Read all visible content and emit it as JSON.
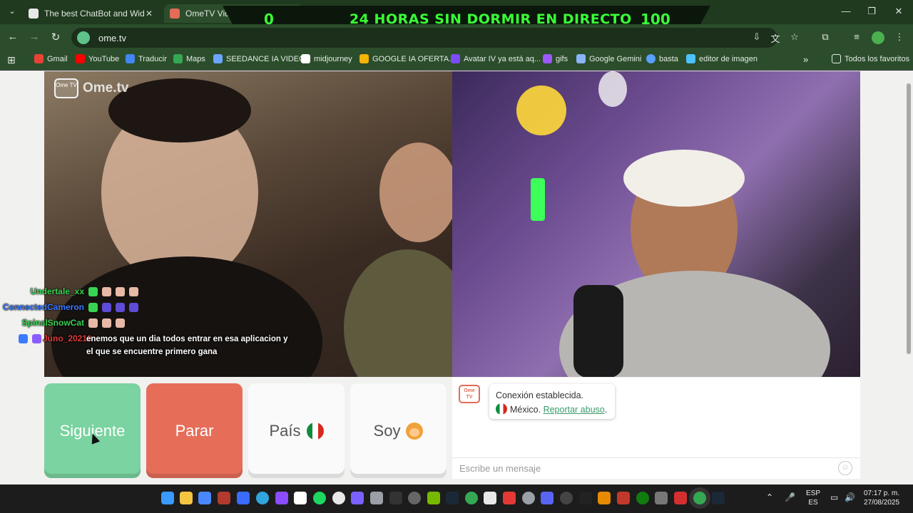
{
  "tabs": [
    {
      "title": "The best ChatBot and Widgets",
      "favicon_color": "#e8e8e8"
    },
    {
      "title": "OmeTV Video Chat — Ome",
      "favicon_color": "#e46b57",
      "active": true
    }
  ],
  "banner": {
    "left_number": "0",
    "title": "24 HORAS SIN DORMIR EN DIRECTO",
    "right_number": "100"
  },
  "address_bar": {
    "url": "ome.tv"
  },
  "bookmarks": [
    {
      "label": "Gmail",
      "color": "#ea4335"
    },
    {
      "label": "YouTube",
      "color": "#ff0000"
    },
    {
      "label": "Traducir",
      "color": "#4285f4"
    },
    {
      "label": "Maps",
      "color": "#34a853"
    },
    {
      "label": "SEEDANCE IA VIDEO",
      "color": "#6aa6ff"
    },
    {
      "label": "midjourney",
      "color": "#ffffff"
    },
    {
      "label": "GOOGLE IA OFERTA...",
      "color": "#f4b400"
    },
    {
      "label": "Avatar IV ya está aq...",
      "color": "#7b4dff"
    },
    {
      "label": "gifs",
      "color": "#9b59ff"
    },
    {
      "label": "Google Gemini",
      "color": "#8ab4f8"
    },
    {
      "label": "basta",
      "color": "#5aa0ff"
    },
    {
      "label": "editor de imagen",
      "color": "#4cc2ff"
    }
  ],
  "all_bookmarks_label": "Todos los favoritos",
  "site_logo": {
    "tv_text": "Ome TV",
    "text": "Ome.tv"
  },
  "chat_overlay": [
    {
      "name": "Undertale_xx",
      "color": "#39d353"
    },
    {
      "name": "ConnectedCameron",
      "color": "#3b7bff"
    },
    {
      "name": "SpinalSnowCat",
      "color": "#39d353"
    },
    {
      "name": "Juno_20210",
      "color": "#e03a3a"
    }
  ],
  "caption_lines": [
    "enemos que un dia todos entrar en esa aplicacion y",
    "el que se encuentre primero gana"
  ],
  "buttons": {
    "next": "Siguiente",
    "stop": "Parar",
    "country": "País",
    "me": "Soy"
  },
  "chat": {
    "tv_icon_text": "Ome TV",
    "line1": "Conexión establecida.",
    "country": "México.",
    "report_link": "Reportar abuso",
    "tail": ".",
    "input_placeholder": "Escribe un mensaje"
  },
  "tray": {
    "lang_top": "ESP",
    "lang_bottom": "ES",
    "time": "07:17 p. m.",
    "date": "27/08/2025"
  }
}
